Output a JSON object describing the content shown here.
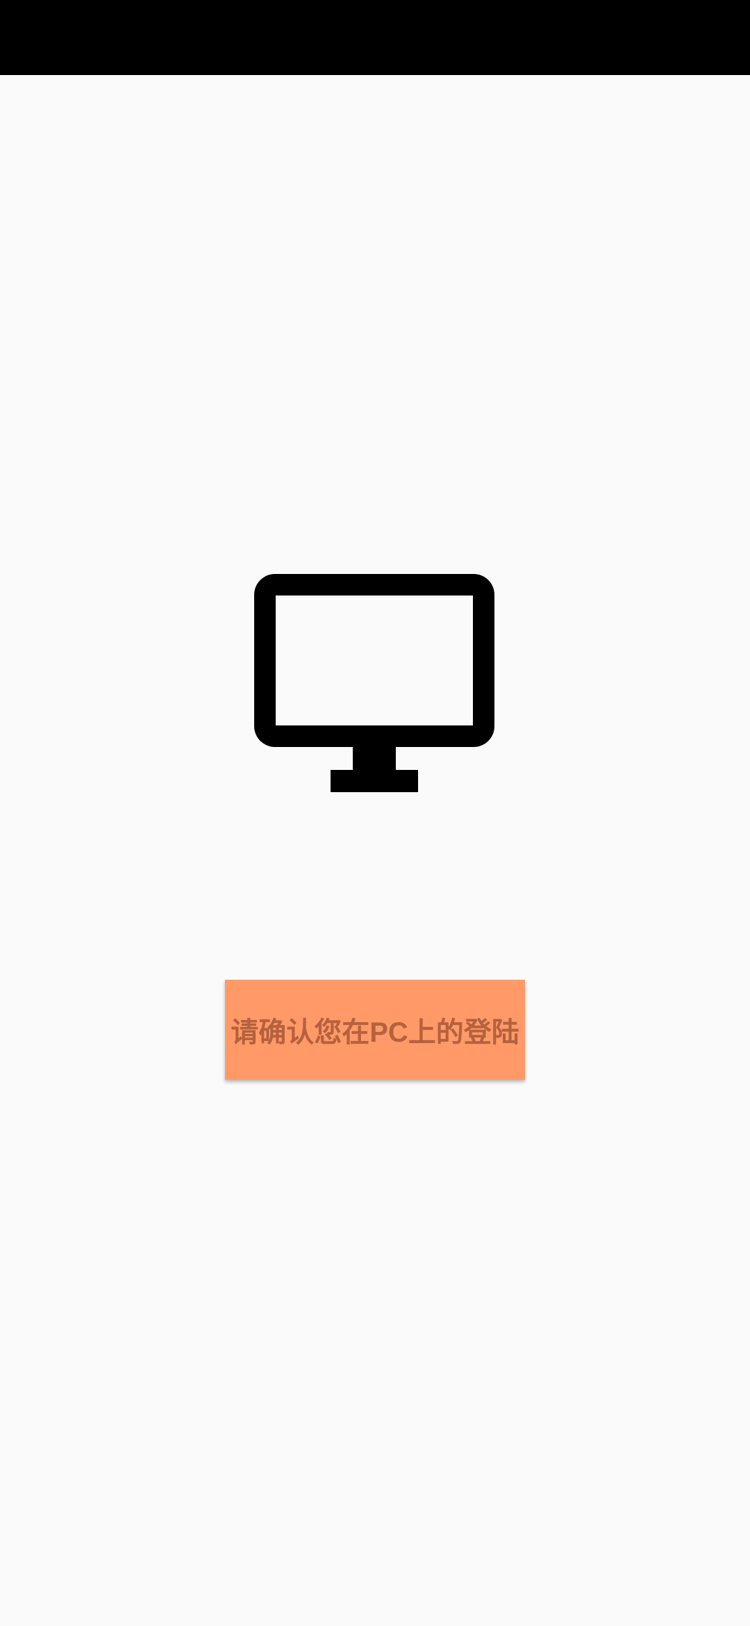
{
  "status_bar": {
    "color": "#000000"
  },
  "main": {
    "icon": "desktop-monitor-icon",
    "confirm_button": {
      "label": "请确认您在PC上的登陆",
      "background": "#ff9a68",
      "text_color": "#b4613e"
    }
  }
}
